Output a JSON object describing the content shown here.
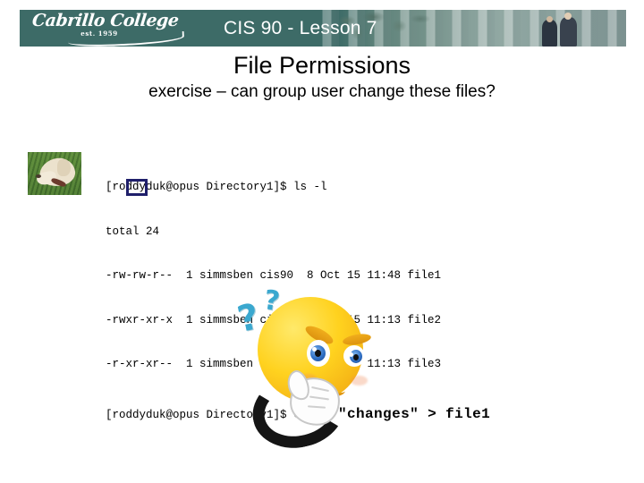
{
  "banner": {
    "logo_wordmark": "Cabrillo College",
    "logo_est": "est. 1959",
    "course_title": "CIS 90 - Lesson 7",
    "teal_color": "#3d6b67"
  },
  "slide": {
    "title": "File Permissions",
    "subtitle": "exercise – can group user change these files?"
  },
  "terminal": {
    "line1": "[roddyduk@opus Directory1]$ ls -l",
    "line2": "total 24",
    "line3": "-rw-rw-r--  1 simmsben cis90  8 Oct 15 11:48 file1",
    "line4": "-rwxr-xr-x  1 simmsben cis90 15 Oct 15 11:13 file2",
    "line5": "-r-xr-xr--  1 simmsben cis90 15 Oct 15 11:13 file3",
    "last_prompt": "[roddyduk@opus Directory1]$ ",
    "last_command": "echo \"changes\" > file1",
    "highlight_color": "#1f1f6b",
    "highlight_target": "rw"
  },
  "emoji": {
    "question_mark_big": "?",
    "question_mark_small": "?"
  }
}
